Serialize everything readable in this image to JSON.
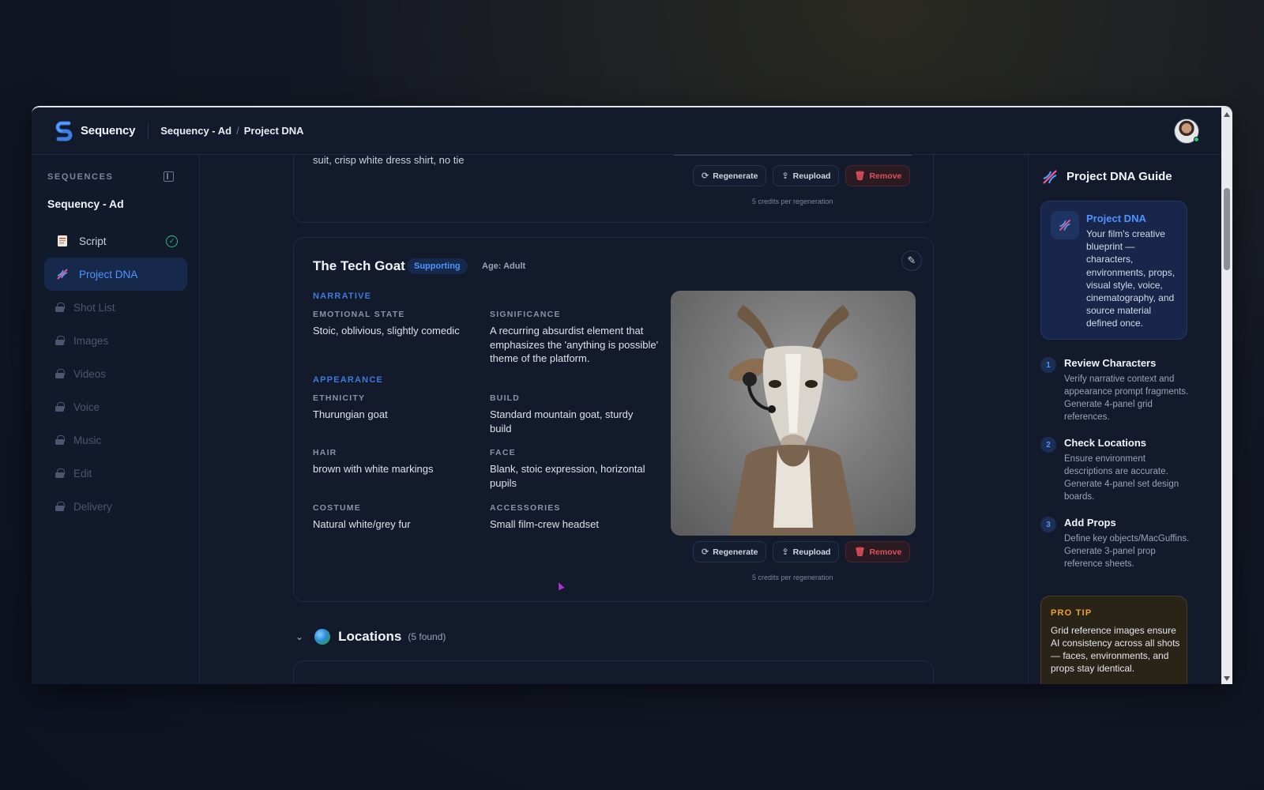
{
  "header": {
    "brand": "Sequency",
    "breadcrumb": [
      "Sequency - Ad",
      "/",
      "Project DNA"
    ]
  },
  "sidebar": {
    "heading": "SEQUENCES",
    "project": "Sequency - Ad",
    "items": [
      {
        "label": "Script",
        "state": "complete",
        "icon": "script-icon"
      },
      {
        "label": "Project DNA",
        "state": "active",
        "icon": "dna-icon"
      },
      {
        "label": "Shot List",
        "state": "locked",
        "icon": "lock-icon"
      },
      {
        "label": "Images",
        "state": "locked",
        "icon": "lock-icon"
      },
      {
        "label": "Videos",
        "state": "locked",
        "icon": "lock-icon"
      },
      {
        "label": "Voice",
        "state": "locked",
        "icon": "lock-icon"
      },
      {
        "label": "Music",
        "state": "locked",
        "icon": "lock-icon"
      },
      {
        "label": "Edit",
        "state": "locked",
        "icon": "lock-icon"
      },
      {
        "label": "Delivery",
        "state": "locked",
        "icon": "lock-icon"
      }
    ]
  },
  "prev_card": {
    "text": "suit, crisp white dress shirt, no tie",
    "buttons": {
      "regenerate": "Regenerate",
      "reupload": "Reupload",
      "remove": "Remove"
    },
    "credits": "5 credits per regeneration"
  },
  "character": {
    "name": "The Tech Goat",
    "role": "Supporting",
    "age": "Age: Adult",
    "narrative_title": "NARRATIVE",
    "emotional_state_label": "EMOTIONAL STATE",
    "emotional_state": "Stoic, oblivious, slightly comedic",
    "significance_label": "SIGNIFICANCE",
    "significance": "A recurring absurdist element that emphasizes the 'anything is possible' theme of the platform.",
    "appearance_title": "APPEARANCE",
    "ethnicity_label": "ETHNICITY",
    "ethnicity": "Thurungian goat",
    "build_label": "BUILD",
    "build": "Standard mountain goat, sturdy build",
    "hair_label": "HAIR",
    "hair": "brown with white markings",
    "face_label": "FACE",
    "face": "Blank, stoic expression, horizontal pupils",
    "costume_label": "COSTUME",
    "costume": "Natural white/grey fur",
    "accessories_label": "ACCESSORIES",
    "accessories": "Small film-crew headset",
    "buttons": {
      "regenerate": "Regenerate",
      "reupload": "Reupload",
      "remove": "Remove"
    },
    "credits": "5 credits per regeneration"
  },
  "locations": {
    "title": "Locations",
    "count": "(5 found)"
  },
  "guide": {
    "title": "Project DNA Guide",
    "info_title": "Project DNA",
    "info_body": "Your film's creative blueprint — characters, environments, props, visual style, voice, cinematography, and source material defined once.",
    "steps": [
      {
        "num": "1",
        "title": "Review Characters",
        "body": "Verify narrative context and appearance prompt fragments. Generate 4-panel grid references."
      },
      {
        "num": "2",
        "title": "Check Locations",
        "body": "Ensure environment descriptions are accurate. Generate 4-panel set design boards."
      },
      {
        "num": "3",
        "title": "Add Props",
        "body": "Define key objects/MacGuffins. Generate 3-panel prop reference sheets."
      }
    ],
    "tip_label": "PRO TIP",
    "tip_body": "Grid reference images ensure AI consistency across all shots — faces, environments, and props stay identical."
  },
  "colors": {
    "accent": "#4f93ff",
    "success": "#2bbf7a",
    "danger": "#e0505c",
    "tip": "#f0a030"
  }
}
